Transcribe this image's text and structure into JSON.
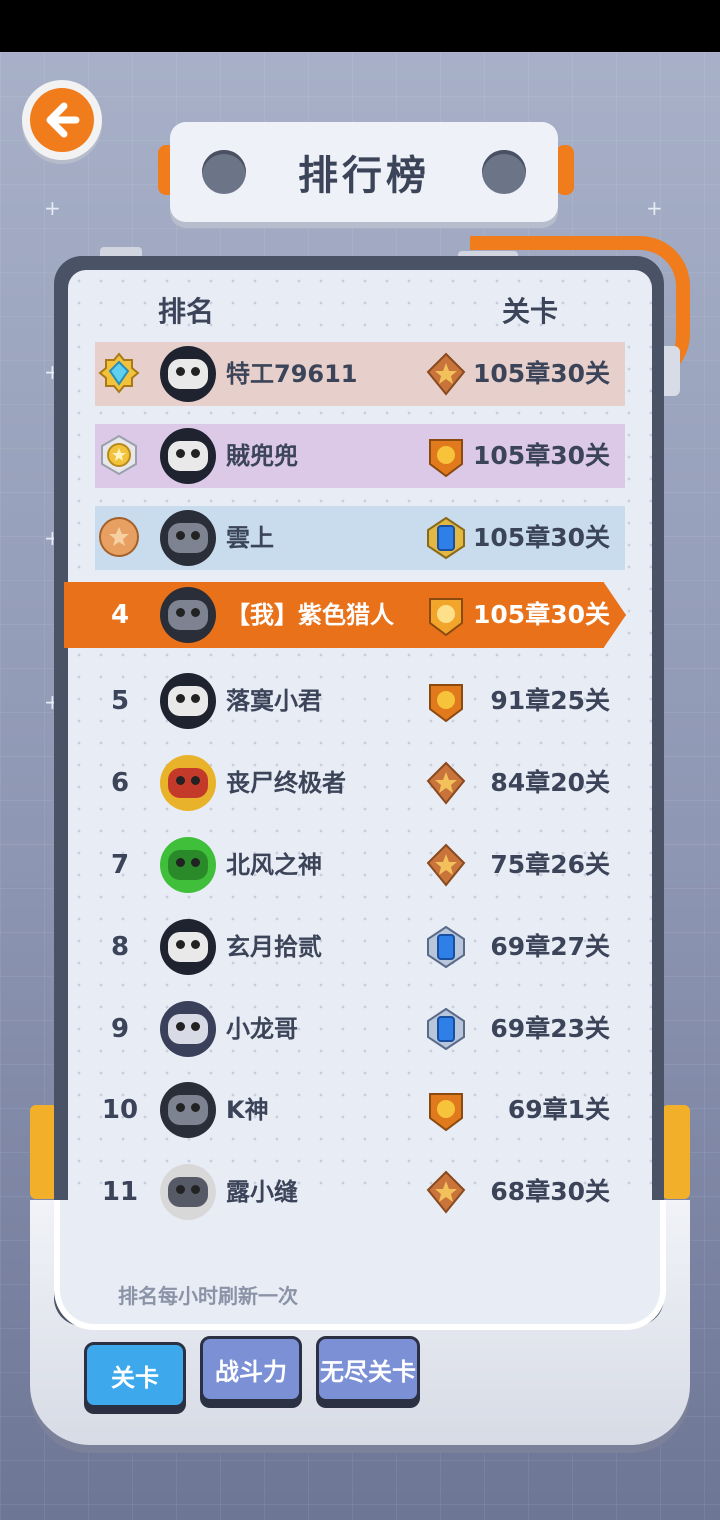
{
  "title": "排行榜",
  "columns": {
    "rank": "排名",
    "stage": "关卡"
  },
  "rows": [
    {
      "rank": "",
      "name": "特工79611",
      "stage": "105章30关",
      "medal": "diamond-medal",
      "badge": "bronze-star-badge"
    },
    {
      "rank": "",
      "name": "賊兜兜",
      "stage": "105章30关",
      "medal": "gold-medal",
      "badge": "gold-skull-badge"
    },
    {
      "rank": "",
      "name": "雲上",
      "stage": "105章30关",
      "medal": "bronze-medal",
      "badge": "blue-gem-badge"
    },
    {
      "rank": "4",
      "name": "【我】紫色猎人",
      "stage": "105章30关",
      "badge": "gold-skull-badge"
    },
    {
      "rank": "5",
      "name": "落寞小君",
      "stage": "91章25关",
      "badge": "gold-skull-badge"
    },
    {
      "rank": "6",
      "name": "丧尸终极者",
      "stage": "84章20关",
      "badge": "bronze-star-badge"
    },
    {
      "rank": "7",
      "name": "北风之神",
      "stage": "75章26关",
      "badge": "bronze-star-badge"
    },
    {
      "rank": "8",
      "name": "玄月拾贰",
      "stage": "69章27关",
      "badge": "blue-gem-badge"
    },
    {
      "rank": "9",
      "name": "小龙哥",
      "stage": "69章23关",
      "badge": "blue-gem-badge"
    },
    {
      "rank": "10",
      "name": "K神",
      "stage": "69章1关",
      "badge": "gold-skull-badge"
    },
    {
      "rank": "11",
      "name": "露小缝",
      "stage": "68章30关",
      "badge": "bronze-star-badge"
    }
  ],
  "refresh_note": "排名每小时刷新一次",
  "tabs": [
    {
      "label": "关卡",
      "active": true
    },
    {
      "label": "战斗力",
      "active": false
    },
    {
      "label": "无尽关卡",
      "active": false
    }
  ],
  "colors": {
    "accent": "#f07c1c",
    "row1": "#e7cfcb",
    "row2": "#dcc9e8",
    "row3": "#c9dcee",
    "active_tab": "#3ea8ec",
    "idle_tab": "#7c90d6"
  }
}
